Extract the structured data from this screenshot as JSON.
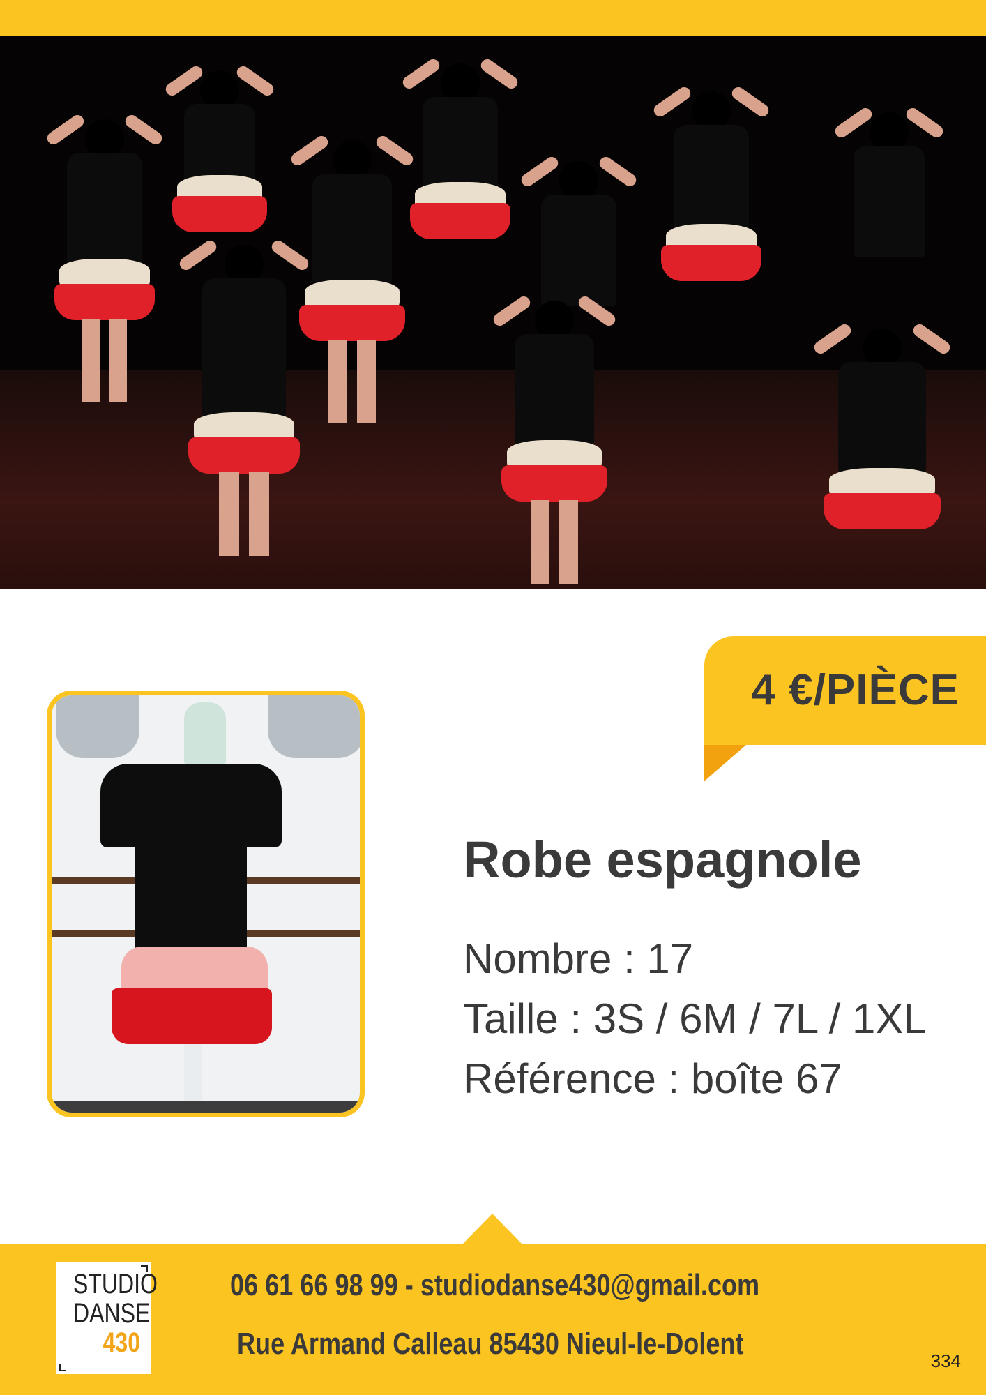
{
  "price": {
    "label": "4 €/PIÈCE"
  },
  "product": {
    "title": "Robe espagnole",
    "count_line": "Nombre : 17",
    "size_line": "Taille : 3S / 6M / 7L / 1XL",
    "reference_line": "Référence : boîte 67"
  },
  "footer": {
    "logo": {
      "line1": "STUDIO",
      "line2": "DANSE",
      "line3": "430"
    },
    "contact_line": "06 61 66 98 99 - studiodanse430@gmail.com",
    "address_line": "Rue Armand Calleau 85430 Nieul-le-Dolent",
    "page_number": "334"
  },
  "colors": {
    "accent_yellow": "#fcc421",
    "accent_orange": "#f3a20f",
    "text_dark": "#3a3a3a"
  }
}
